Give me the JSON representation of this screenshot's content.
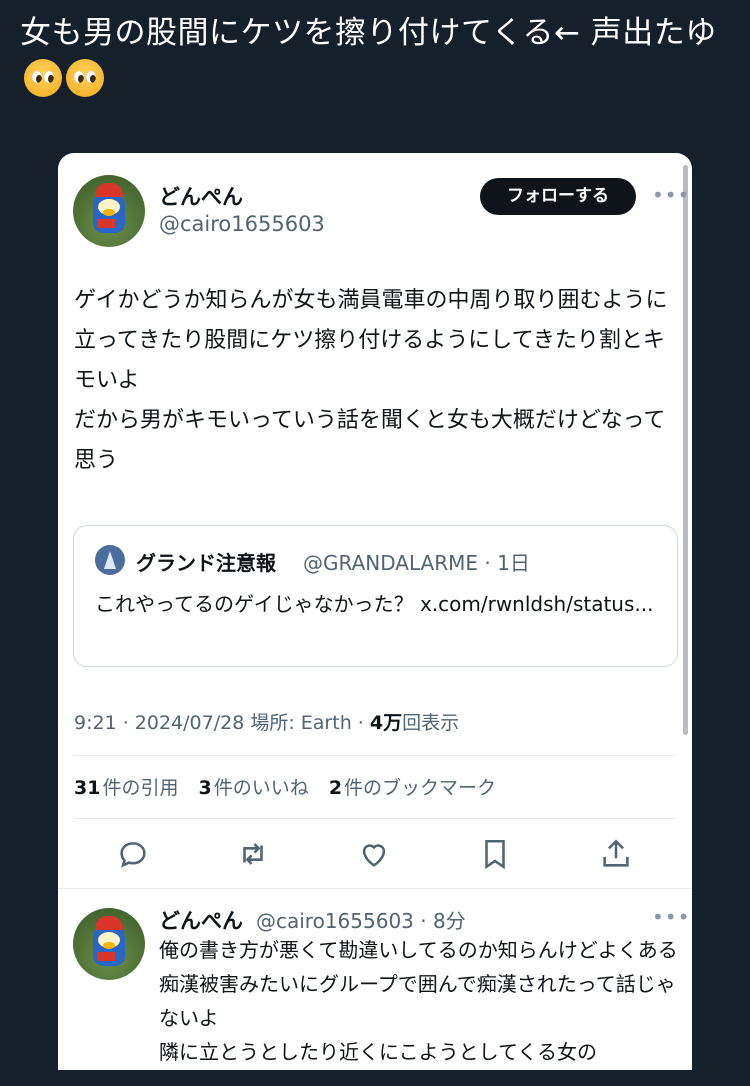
{
  "caption": {
    "text": "女も男の股間にケツを擦り付けてくる← 声出たゆ",
    "emoji": [
      "pleading-face-emoji",
      "pleading-face-emoji"
    ]
  },
  "tweet": {
    "display_name": "どんぺん",
    "handle": "@cairo1655603",
    "follow_label": "フォローする",
    "more_label": "•••",
    "body": "ゲイかどうか知らんが女も満員電車の中周り取り囲むように立ってきたり股間にケツ擦り付けるようにしてきたり割とキモいよ\nだから男がキモいっていう話を聞くと女も大概だけどなって思う",
    "quote": {
      "display_name": "グランド注意報",
      "handle_time": "@GRANDALARME · 1日",
      "text": "これやってるのゲイじゃなかった？ x.com/rwnldsh/status..."
    },
    "time": "9:21 · 2024/07/28",
    "location": "場所: Earth ·",
    "views_count": "4万",
    "views_label": "回表示",
    "stats": [
      {
        "count": "31",
        "label": "件の引用"
      },
      {
        "count": "3",
        "label": "件のいいね"
      },
      {
        "count": "2",
        "label": "件のブックマーク"
      }
    ],
    "actions": [
      "reply-icon",
      "retweet-icon",
      "like-icon",
      "bookmark-icon",
      "share-icon"
    ]
  },
  "reply": {
    "display_name": "どんぺん",
    "handle_time": "@cairo1655603 · 8分",
    "more_label": "•••",
    "body": "俺の書き方が悪くて勘違いしてるのか知らんけどよくある痴漢被害みたいにグループで囲んで痴漢されたって話じゃないよ\n隣に立とうとしたり近くにこようとしてくる女の"
  },
  "colors": {
    "background": "#15202b",
    "card": "#ffffff",
    "text": "#0f1419",
    "muted": "#536471",
    "follow_button": "#0f1419"
  }
}
